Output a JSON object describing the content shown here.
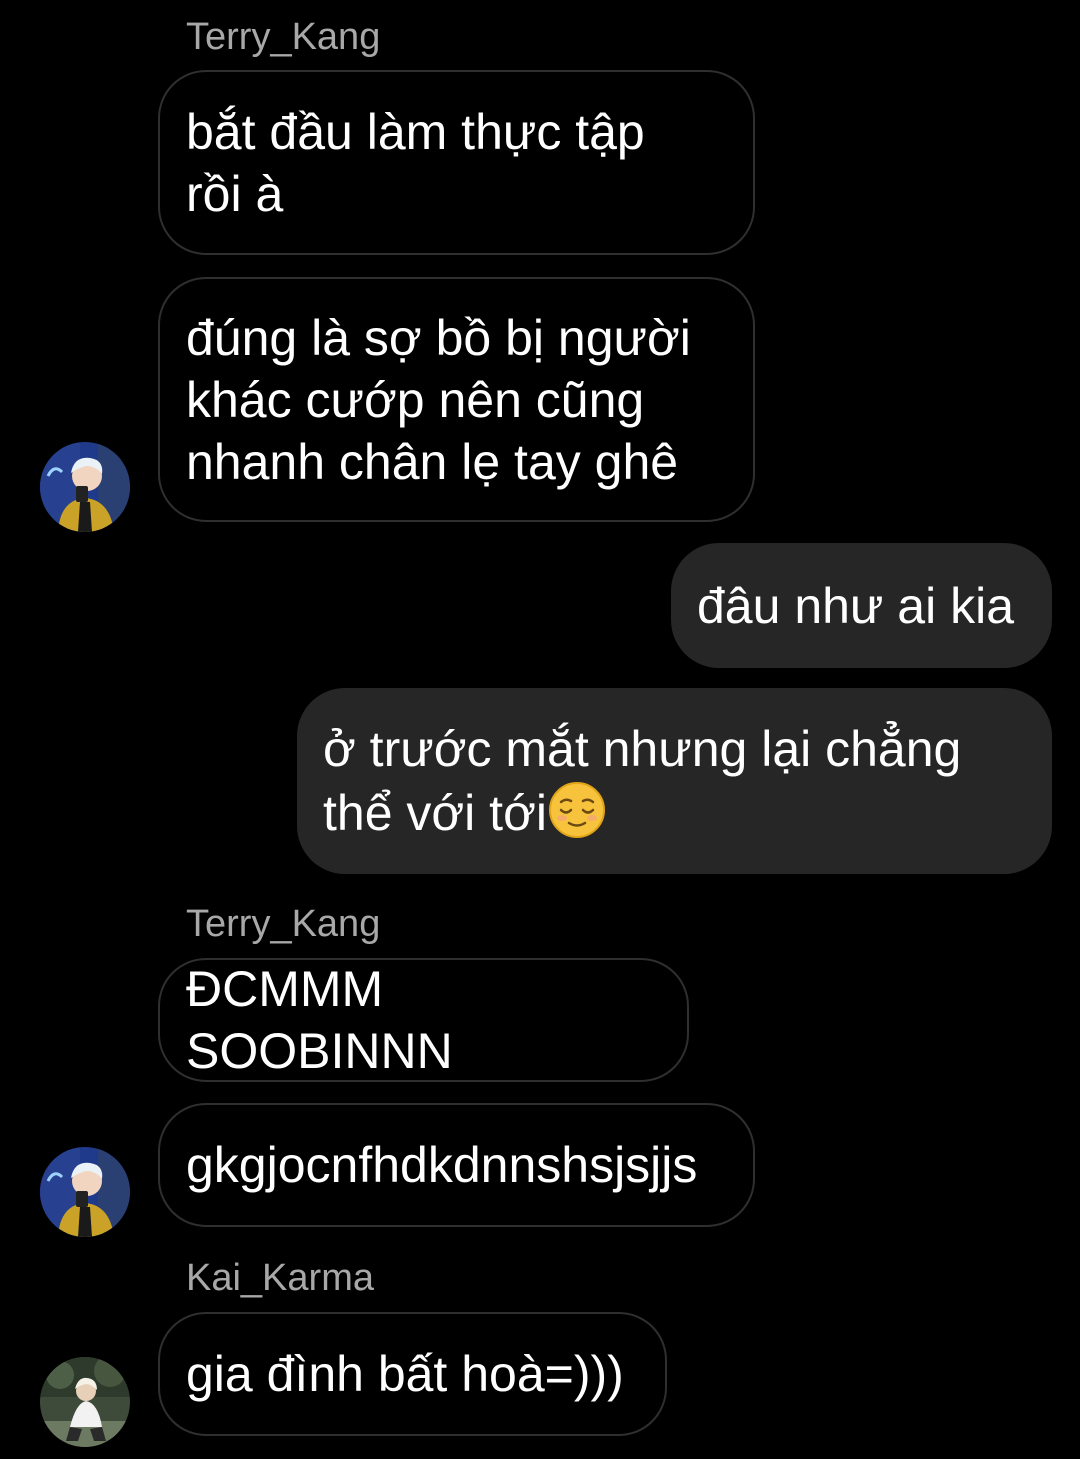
{
  "messages": [
    {
      "sender": "Terry_Kang",
      "text": "bắt đầu làm thực tập\nrồi à"
    },
    {
      "text": "đúng là sợ bồ bị người\nkhác cướp nên cũng\nnhanh chân lẹ tay ghê"
    },
    {
      "text": "đâu như ai kia"
    },
    {
      "text": "ở trước mắt nhưng lại chẳng\nthể với tới"
    },
    {
      "sender": "Terry_Kang",
      "text": "ĐCMMM SOOBINNN"
    },
    {
      "text": "gkgjocnfhdkdnnshsjsjjs"
    },
    {
      "sender": "Kai_Karma",
      "text": "gia đình bất hoà=)))"
    }
  ],
  "colors": {
    "background": "#000000",
    "incoming_border": "#2f2f2f",
    "outgoing_bubble": "#262626",
    "sender_name": "#a8a8a8",
    "text": "#ffffff"
  },
  "icons": {
    "emoji": "relieved-face-emoji",
    "avatar_terry": "terry-kang-avatar",
    "avatar_kai": "kai-karma-avatar"
  }
}
